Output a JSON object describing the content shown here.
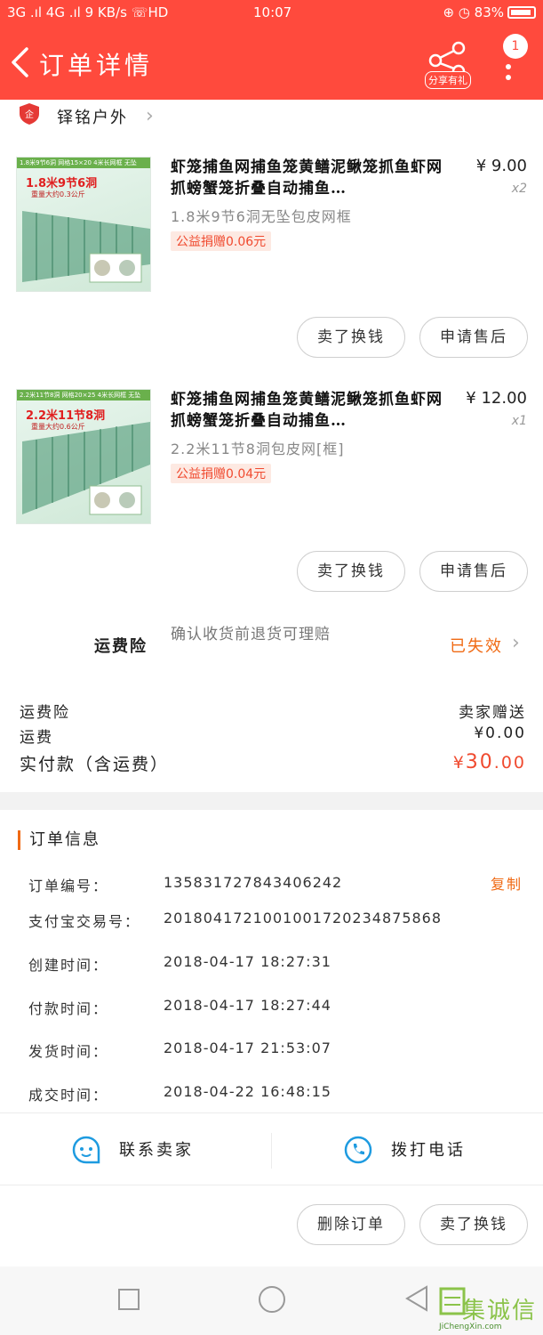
{
  "status_bar": {
    "left": "3G .ıl 4G .ıl 9 KB/s ☏HD",
    "time": "10:07",
    "right": "⊕ ◷ 83%"
  },
  "header": {
    "title": "订单详情",
    "share_label": "分享有礼",
    "badge": "1"
  },
  "shop": {
    "name": "铎铭户外"
  },
  "items": [
    {
      "thumb_spec": "1.8米9节6洞  网格15×20  4米长网框  无坠",
      "thumb_big": "1.8米9节6洞",
      "thumb_sub": "重量大约0.3公斤",
      "title": "虾笼捕鱼网捕鱼笼黄鳝泥鳅笼抓鱼虾网抓螃蟹笼折叠自动捕鱼…",
      "price": "¥ 9.00",
      "qty": "x2",
      "spec": "1.8米9节6洞无坠包皮网框",
      "donation": "公益捐赠0.06元",
      "btn_sell": "卖了换钱",
      "btn_after": "申请售后"
    },
    {
      "thumb_spec": "2.2米11节8洞  网格20×25  4米长网框  无坠",
      "thumb_big": "2.2米11节8洞",
      "thumb_sub": "重量大约0.6公斤",
      "title": "虾笼捕鱼网捕鱼笼黄鳝泥鳅笼抓鱼虾网抓螃蟹笼折叠自动捕鱼…",
      "price": "¥ 12.00",
      "qty": "x1",
      "spec": "2.2米11节8洞包皮网[框]",
      "donation": "公益捐赠0.04元",
      "btn_sell": "卖了换钱",
      "btn_after": "申请售后"
    }
  ],
  "insurance": {
    "label": "运费险",
    "desc": "确认收货前退货可理赔",
    "status": "已失效"
  },
  "summary": {
    "ins_label": "运费险",
    "ins_value": "卖家赠送",
    "ship_label": "运费",
    "ship_value": "¥0.00",
    "total_label": "实付款（含运费）",
    "total_currency": "¥",
    "total_int": "30",
    "total_dec": ".00"
  },
  "order_info": {
    "heading": "订单信息",
    "copy": "复制",
    "rows": [
      {
        "k": "订单编号：",
        "v": "135831727843406242"
      },
      {
        "k": "支付宝交易号：",
        "v": "2018041721001001720234875868"
      },
      {
        "k": "创建时间：",
        "v": "2018-04-17 18:27:31"
      },
      {
        "k": "付款时间：",
        "v": "2018-04-17 18:27:44"
      },
      {
        "k": "发货时间：",
        "v": "2018-04-17 21:53:07"
      },
      {
        "k": "成交时间：",
        "v": "2018-04-22 16:48:15"
      }
    ]
  },
  "contact": {
    "seller": "联系卖家",
    "phone": "拨打电话"
  },
  "bottom": {
    "delete": "删除订单",
    "sell": "卖了换钱"
  },
  "watermark": {
    "text": "集诚信",
    "url": "JiChengXin.com"
  },
  "colors": {
    "header": "#ff4a3d",
    "accent_orange": "#f06a14",
    "price_red": "#f04a2f"
  }
}
